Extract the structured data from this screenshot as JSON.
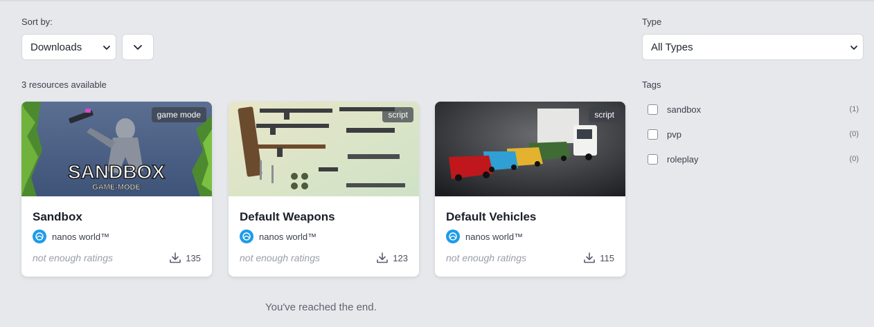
{
  "filters": {
    "sort_label": "Sort by:",
    "sort_value": "Downloads",
    "type_label": "Type",
    "type_value": "All Types",
    "tags_label": "Tags",
    "tags": [
      {
        "name": "sandbox",
        "count": "(1)"
      },
      {
        "name": "pvp",
        "count": "(0)"
      },
      {
        "name": "roleplay",
        "count": "(0)"
      }
    ]
  },
  "results": {
    "count_text": "3 resources available",
    "end_text": "You've reached the end."
  },
  "cards": [
    {
      "title": "Sandbox",
      "badge": "game mode",
      "author": "nanos world™",
      "rating": "not enough ratings",
      "downloads": "135",
      "image_title": "SANDBOX",
      "image_subtitle": "GAME-MODE"
    },
    {
      "title": "Default Weapons",
      "badge": "script",
      "author": "nanos world™",
      "rating": "not enough ratings",
      "downloads": "123"
    },
    {
      "title": "Default Vehicles",
      "badge": "script",
      "author": "nanos world™",
      "rating": "not enough ratings",
      "downloads": "115"
    }
  ],
  "colors": {
    "background": "#e7e8ec",
    "author_avatar": "#1e9be9",
    "rating_text": "#9a9ea8"
  },
  "icons": {
    "select_chevron": "chevron-down-icon",
    "download": "download-icon",
    "author": "nanos-world-logo-icon"
  }
}
